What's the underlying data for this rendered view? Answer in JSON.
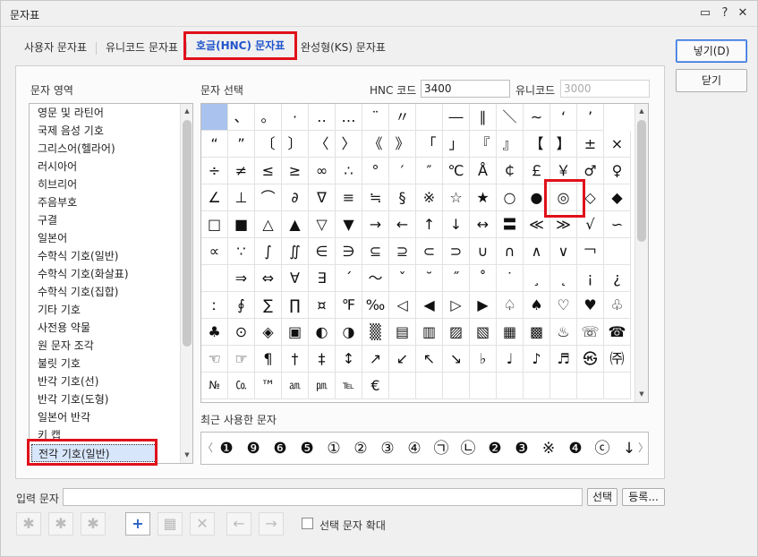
{
  "window": {
    "title": "문자표",
    "controls": [
      "▭",
      "?",
      "✕"
    ]
  },
  "tabs": [
    {
      "label": "사용자 문자표"
    },
    {
      "label": "유니코드 문자표"
    },
    {
      "label": "호글(HNC) 문자표",
      "active": true
    },
    {
      "label": "완성형(KS) 문자표"
    }
  ],
  "area_section": {
    "label": "문자 영역",
    "items": [
      "영문 및 라틴어",
      "국제 음성 기호",
      "그리스어(헬라어)",
      "러시아어",
      "히브리어",
      "주음부호",
      "구결",
      "일본어",
      "수학식 기호(일반)",
      "수학식 기호(화살표)",
      "수학식 기호(집합)",
      "기타 기호",
      "사전용 약물",
      "원 문자 조각",
      "불릿 기호",
      "반각 기호(선)",
      "반각 기호(도형)",
      "일본어 반각",
      "키 캡",
      "전각 기호(일반)"
    ],
    "selected": "전각 기호(일반)"
  },
  "char_section": {
    "label": "문자 선택",
    "hnc_label": "HNC 코드",
    "hnc_value": "3400",
    "unicode_label": "유니코드",
    "unicode_value": "3000",
    "chars": [
      [
        "",
        "、",
        "。",
        "·",
        "‥",
        "…",
        "¨",
        "〃",
        "­",
        "―",
        "∥",
        "＼",
        "∼",
        "‘",
        "’"
      ],
      [
        "“",
        "”",
        "〔",
        "〕",
        "〈",
        "〉",
        "《",
        "》",
        "「",
        "」",
        "『",
        "』",
        "【",
        "】",
        "±",
        "×"
      ],
      [
        "÷",
        "≠",
        "≤",
        "≥",
        "∞",
        "∴",
        "°",
        "′",
        "″",
        "℃",
        "Å",
        "￠",
        "￡",
        "￥",
        "♂",
        "♀"
      ],
      [
        "∠",
        "⊥",
        "⌒",
        "∂",
        "∇",
        "≡",
        "≒",
        "§",
        "※",
        "☆",
        "★",
        "○",
        "●",
        "◎",
        "◇",
        "◆"
      ],
      [
        "□",
        "■",
        "△",
        "▲",
        "▽",
        "▼",
        "→",
        "←",
        "↑",
        "↓",
        "↔",
        "〓",
        "≪",
        "≫",
        "√",
        "∽"
      ],
      [
        "∝",
        "∵",
        "∫",
        "∬",
        "∈",
        "∋",
        "⊆",
        "⊇",
        "⊂",
        "⊃",
        "∪",
        "∩",
        "∧",
        "∨",
        "￢",
        ""
      ],
      [
        "",
        "⇒",
        "⇔",
        "∀",
        "∃",
        "´",
        "～",
        "ˇ",
        "˘",
        "˝",
        "˚",
        "˙",
        "¸",
        "˛",
        "¡",
        "¿"
      ],
      [
        "ː",
        "∮",
        "∑",
        "∏",
        "¤",
        "℉",
        "‰",
        "◁",
        "◀",
        "▷",
        "▶",
        "♤",
        "♠",
        "♡",
        "♥",
        "♧"
      ],
      [
        "♣",
        "⊙",
        "◈",
        "▣",
        "◐",
        "◑",
        "▒",
        "▤",
        "▥",
        "▨",
        "▧",
        "▦",
        "▩",
        "♨",
        "☏",
        "☎"
      ],
      [
        "☜",
        "☞",
        "¶",
        "†",
        "‡",
        "↕",
        "↗",
        "↙",
        "↖",
        "↘",
        "♭",
        "♩",
        "♪",
        "♬",
        "㉿",
        "㈜"
      ],
      [
        "№",
        "㏇",
        "™",
        "㏂",
        "㏘",
        "℡",
        "€",
        "",
        "",
        "",
        "",
        "",
        "",
        "",
        "",
        ""
      ]
    ]
  },
  "recent_section": {
    "label": "최근 사용한 문자",
    "chars": [
      "❶",
      "❾",
      "❻",
      "❺",
      "①",
      "②",
      "③",
      "④",
      "㉠",
      "㉡",
      "❷",
      "❸",
      "※",
      "❹",
      "ⓒ",
      "↓"
    ],
    "left_arrow": "〈",
    "right_arrow": "〉"
  },
  "buttons": {
    "insert": "넣기(D)",
    "close": "닫기",
    "select": "선택",
    "register": "등록..."
  },
  "input_row": {
    "label": "입력 문자",
    "value": ""
  },
  "toolbar": {
    "icons": [
      "✱",
      "✱",
      "✱",
      "+",
      "▦",
      "✕",
      "←",
      "→"
    ]
  },
  "enlarge_checkbox": {
    "label": "선택 문자 확대",
    "checked": false
  }
}
